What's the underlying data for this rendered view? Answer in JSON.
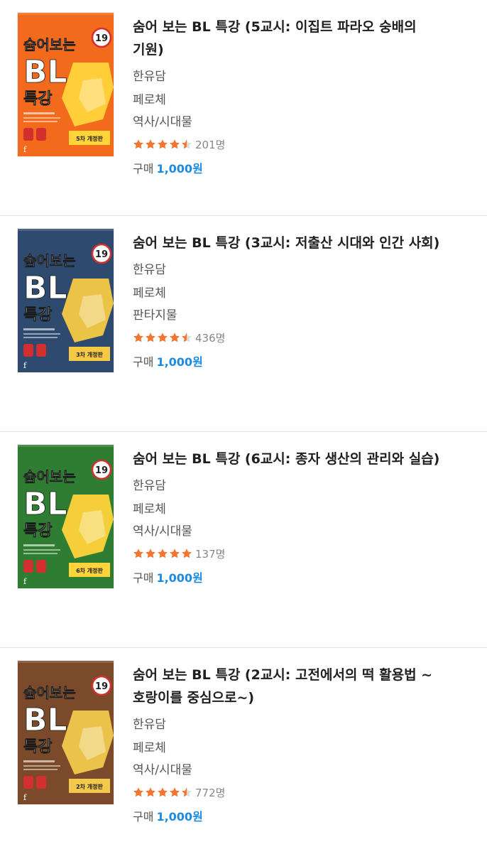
{
  "books": [
    {
      "title": "숨어 보는 BL 특강 (5교시: 이집트 파라오 숭배의 기원)",
      "author": "한유담",
      "publisher": "페로체",
      "genre": "역사/시대물",
      "rating": 4.5,
      "rating_count": "201명",
      "price_label": "구매",
      "price": "1,000원",
      "cover": {
        "bg": "#f26a1b",
        "accent": "#ffd43b",
        "badge": "19",
        "title_line1": "숨어보는",
        "title_line2": "BL",
        "title_line3": "특강",
        "tag": "5차 개정판"
      }
    },
    {
      "title": "숨어 보는 BL 특강 (3교시: 저출산 시대와 인간 사회)",
      "author": "한유담",
      "publisher": "페로체",
      "genre": "판타지물",
      "rating": 4.5,
      "rating_count": "436명",
      "price_label": "구매",
      "price": "1,000원",
      "cover": {
        "bg": "#2e4a6e",
        "accent": "#f6c945",
        "badge": "19",
        "title_line1": "숨어보는",
        "title_line2": "BL",
        "title_line3": "특강",
        "tag": "3차 개정판"
      }
    },
    {
      "title": "숨어 보는 BL 특강 (6교시: 종자 생산의 관리와 실습)",
      "author": "한유담",
      "publisher": "페로체",
      "genre": "역사/시대물",
      "rating": 5,
      "rating_count": "137명",
      "price_label": "구매",
      "price": "1,000원",
      "cover": {
        "bg": "#2f7d32",
        "accent": "#ffd43b",
        "badge": "19",
        "title_line1": "숨어보는",
        "title_line2": "BL",
        "title_line3": "특강",
        "tag": "6차 개정판"
      }
    },
    {
      "title": "숨어 보는 BL 특강 (2교시: 고전에서의 떡 활용법 ~호랑이를 중심으로~)",
      "author": "한유담",
      "publisher": "페로체",
      "genre": "역사/시대물",
      "rating": 4.5,
      "rating_count": "772명",
      "price_label": "구매",
      "price": "1,000원",
      "cover": {
        "bg": "#7a4a2a",
        "accent": "#f2c94c",
        "badge": "19",
        "title_line1": "숨어보는",
        "title_line2": "BL",
        "title_line3": "특강",
        "tag": "2차 개정판"
      }
    }
  ],
  "colors": {
    "star": "#f4752d",
    "star_empty": "#dddddd",
    "price": "#1d8ce0"
  },
  "icons": {
    "rating": "star-icon",
    "age_badge": "adult-19-icon"
  }
}
